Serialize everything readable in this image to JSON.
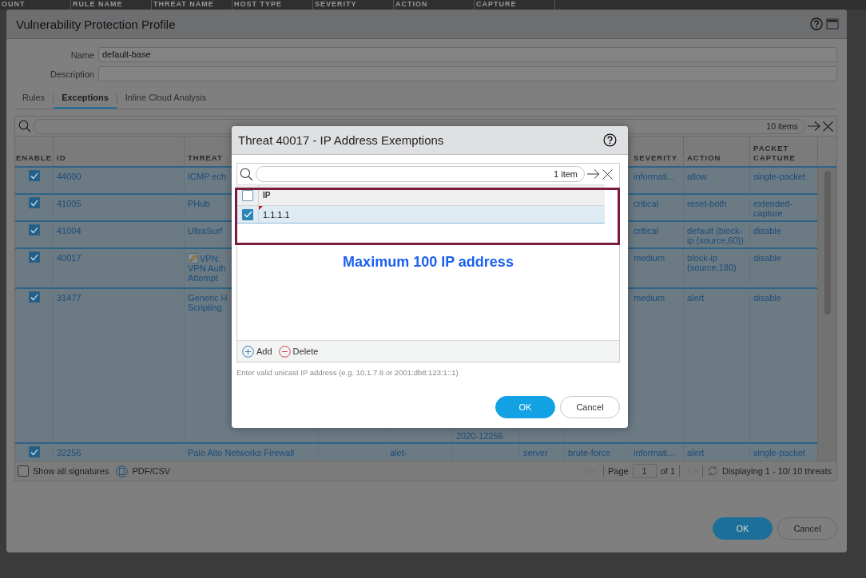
{
  "background_header": {
    "columns": [
      "OUNT",
      "RULE NAME",
      "THREAT NAME",
      "HOST TYPE",
      "SEVERITY",
      "ACTION",
      "CAPTURE"
    ]
  },
  "profile_dialog": {
    "title": "Vulnerability Protection Profile",
    "fields": [
      {
        "label": "Name",
        "value": "default-base"
      },
      {
        "label": "Description"
      }
    ],
    "tabs": [
      {
        "label": "Rules",
        "selected": false
      },
      {
        "label": "Exceptions",
        "selected": true
      },
      {
        "label": "Inline Cloud Analysis",
        "selected": false
      }
    ],
    "exceptions_table": {
      "search": {
        "count": "10 items"
      },
      "columns": {
        "enable": "ENABLE",
        "id": "ID",
        "threat_name": "THREAT",
        "severity": "SEVERITY",
        "action": "ACTION",
        "packet_capture": "PACKET CAPTURE"
      },
      "rows": [
        {
          "enabled": true,
          "edited": false,
          "id": "44000",
          "threat_name": [
            "ICMP ech"
          ],
          "severity": "informati...",
          "action": "allow",
          "packet_capture": "single-packet"
        },
        {
          "enabled": true,
          "edited": false,
          "id": "41005",
          "threat_name": [
            "PHub"
          ],
          "severity": "critical",
          "action": "reset-both",
          "packet_capture": "extended-capture"
        },
        {
          "enabled": true,
          "edited": false,
          "id": "41004",
          "threat_name": [
            "UltraSurf"
          ],
          "severity": "critical",
          "action": "default (block-ip (source,60))",
          "packet_capture": "disable"
        },
        {
          "enabled": true,
          "edited": true,
          "id": "40017",
          "threat_name": [
            "VPN:",
            "VPN Auth",
            "Attempt"
          ],
          "severity": "medium",
          "action": "block-ip (source,180)",
          "packet_capture": "disable"
        },
        {
          "enabled": true,
          "edited": false,
          "id": "31477",
          "threat_name": [
            "Generic H",
            "Scripting"
          ],
          "column_6": "2020-12256",
          "severity": "medium",
          "action": "alert",
          "packet_capture": "disable"
        },
        {
          "enabled": true,
          "edited": false,
          "id": "32256",
          "threat_name": [
            "Palo Alto Networks Firewall"
          ],
          "column_5": "alet-",
          "column_7": "server",
          "column_8": "brute-force",
          "severity": "informati...",
          "action": "alert",
          "packet_capture": "single-packet"
        }
      ],
      "show_all_signatures": {
        "label": "Show all signatures",
        "checked": false
      },
      "export": "PDF/CSV",
      "pager": {
        "page_label": "Page",
        "page": "1",
        "total": "of 1",
        "status": "Displaying 1 - 10/ 10 threats"
      }
    },
    "buttons": [
      {
        "label": "OK",
        "kind": "primary"
      },
      {
        "label": "Cancel",
        "kind": "secondary"
      }
    ]
  },
  "exemptions_dialog": {
    "title": "Threat 40017 - IP Address Exemptions",
    "search": {
      "count": "1 item"
    },
    "select_all": {
      "checked": false
    },
    "column": "IP",
    "rows": [
      {
        "ip": "1.1.1.1",
        "checked": true,
        "modified": true
      }
    ],
    "annotation": "Maximum 100 IP address",
    "actions": [
      {
        "label": "Add",
        "kind": "add"
      },
      {
        "label": "Delete",
        "kind": "delete"
      }
    ],
    "hint": "Enter valid unicast IP address (e.g. 10.1.7.8 or 2001:db8:123:1::1)",
    "buttons": [
      {
        "label": "OK",
        "kind": "primary"
      },
      {
        "label": "Cancel",
        "kind": "secondary"
      }
    ]
  }
}
